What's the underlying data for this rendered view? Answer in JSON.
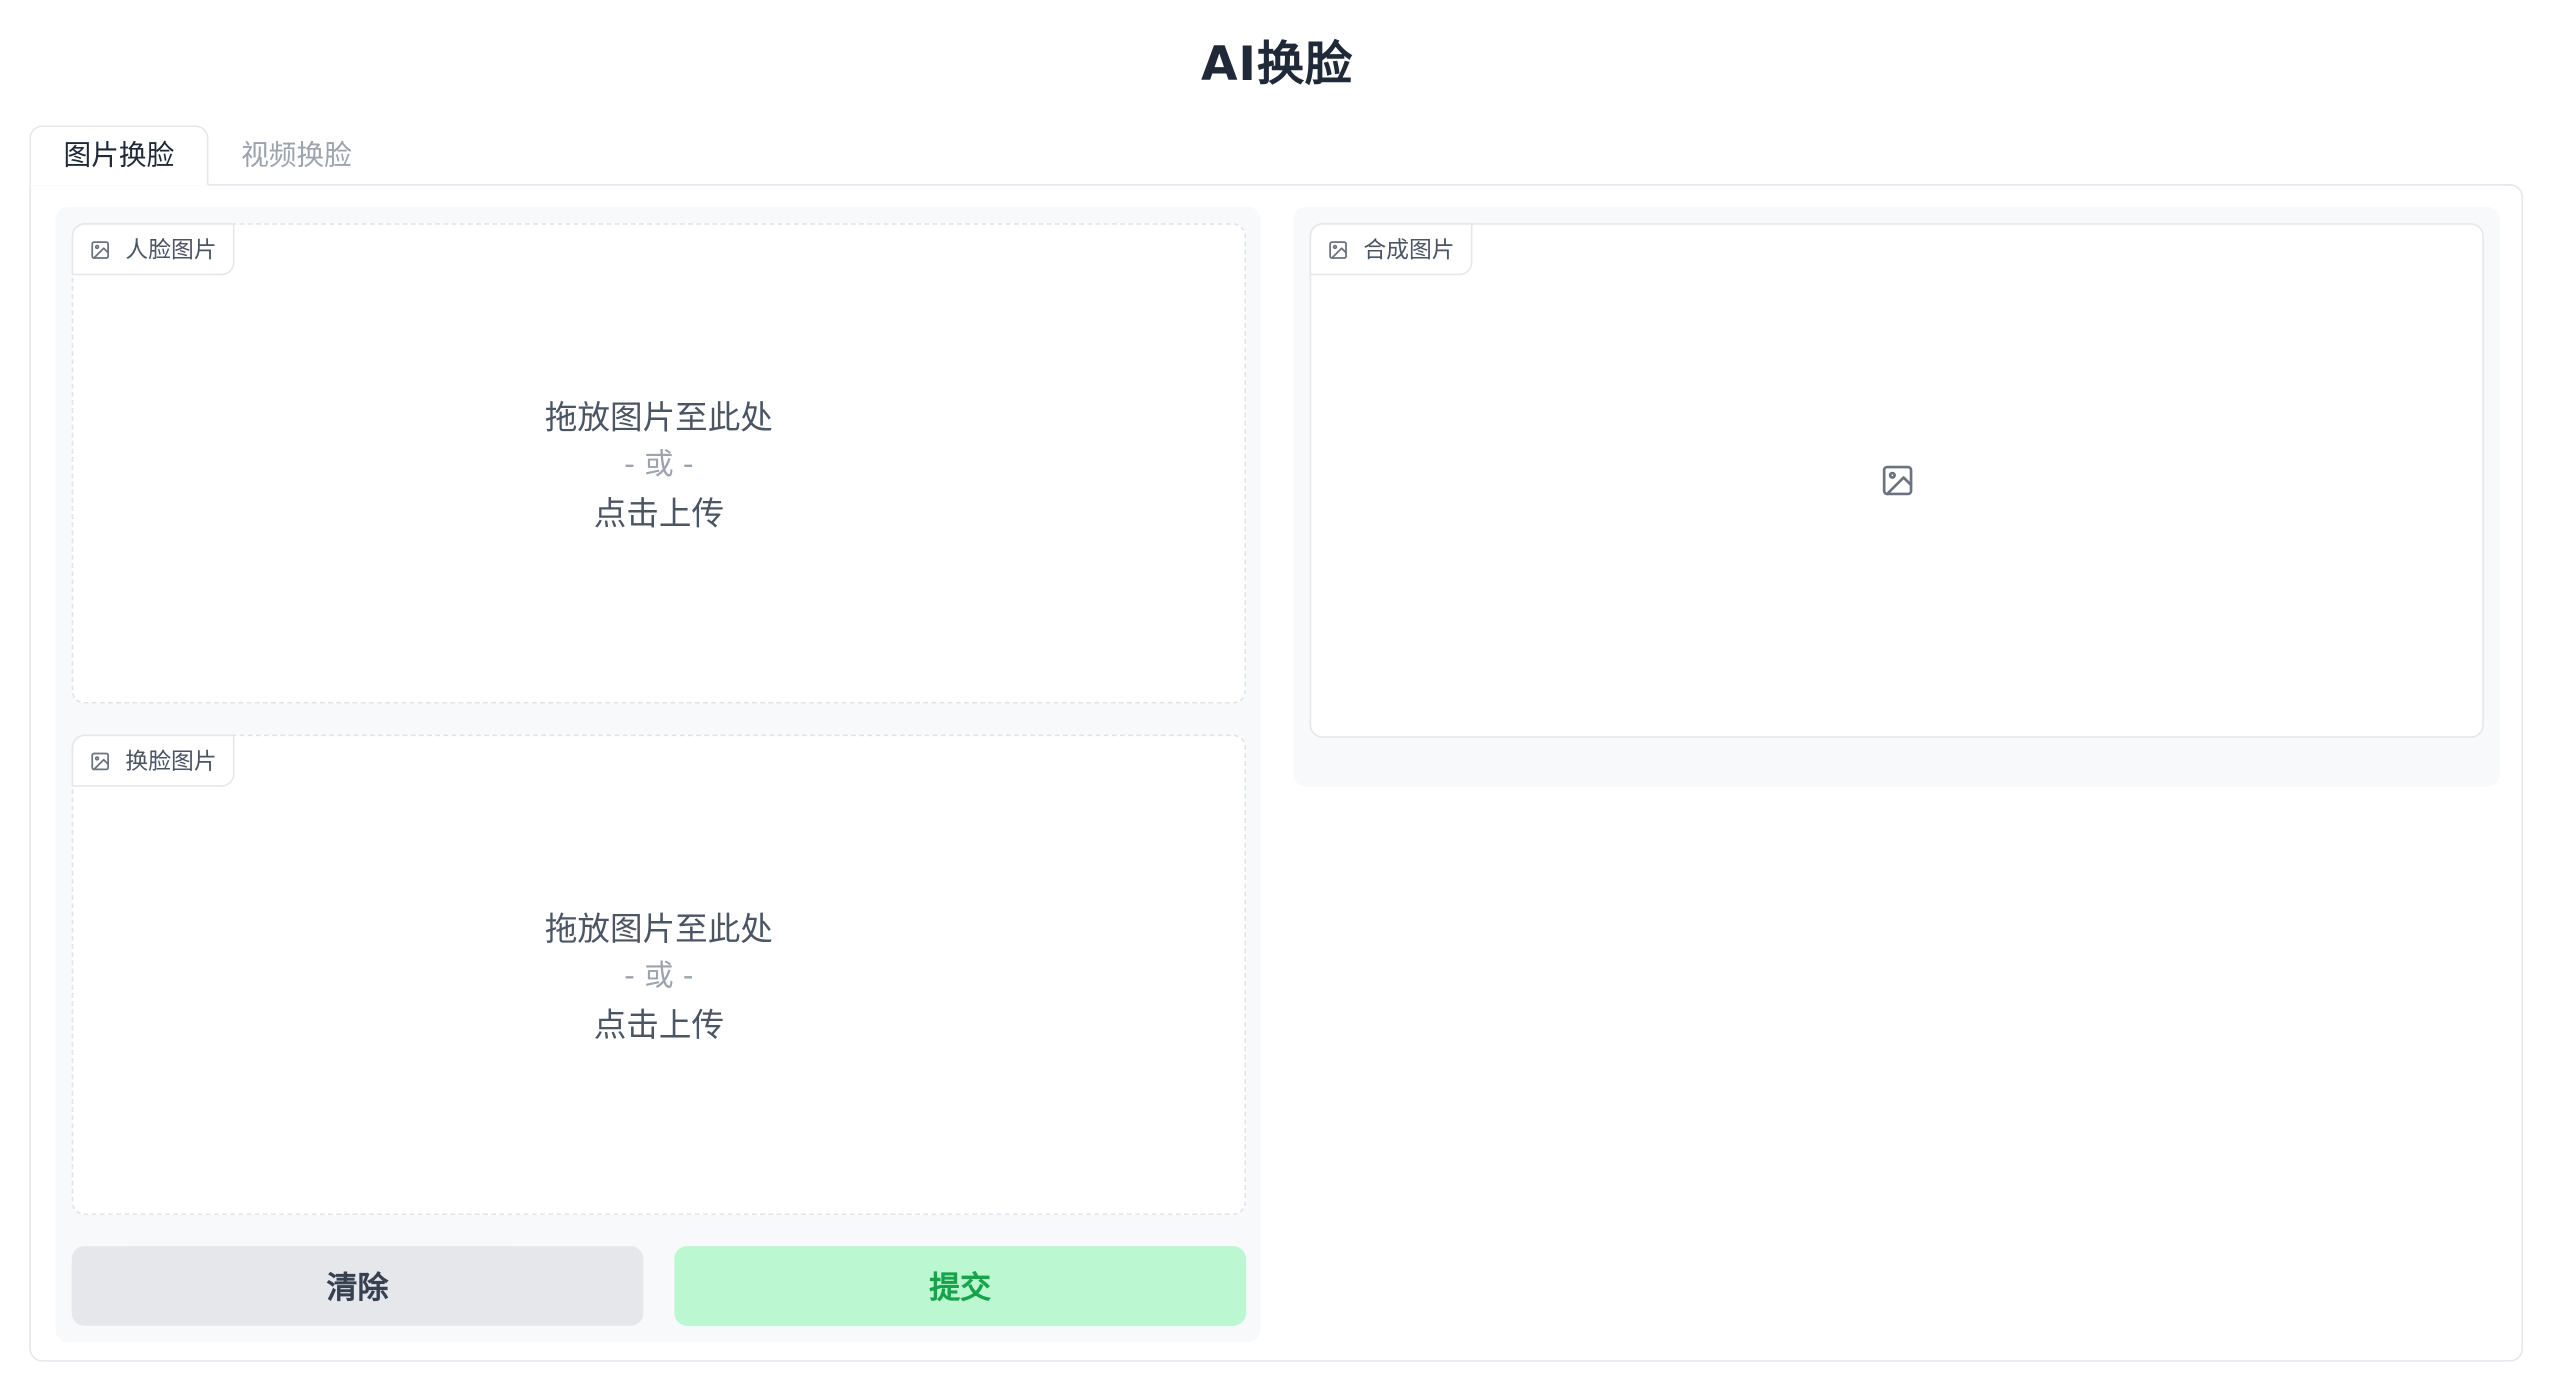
{
  "header": {
    "title": "AI换脸"
  },
  "tabs": [
    {
      "label": "图片换脸",
      "active": true
    },
    {
      "label": "视频换脸",
      "active": false
    }
  ],
  "face_upload": {
    "label": "人脸图片",
    "label_icon": "image-icon",
    "drop_text": "拖放图片至此处",
    "or_text": "- 或 -",
    "click_text": "点击上传"
  },
  "swap_upload": {
    "label": "换脸图片",
    "label_icon": "image-icon",
    "drop_text": "拖放图片至此处",
    "or_text": "- 或 -",
    "click_text": "点击上传"
  },
  "output": {
    "label": "合成图片",
    "label_icon": "image-icon",
    "placeholder_icon": "image-placeholder-icon"
  },
  "buttons": {
    "clear_label": "清除",
    "submit_label": "提交"
  },
  "colors": {
    "submit_bg": "#bbf7d0",
    "submit_text": "#16a34a",
    "clear_bg": "#e5e7eb"
  }
}
